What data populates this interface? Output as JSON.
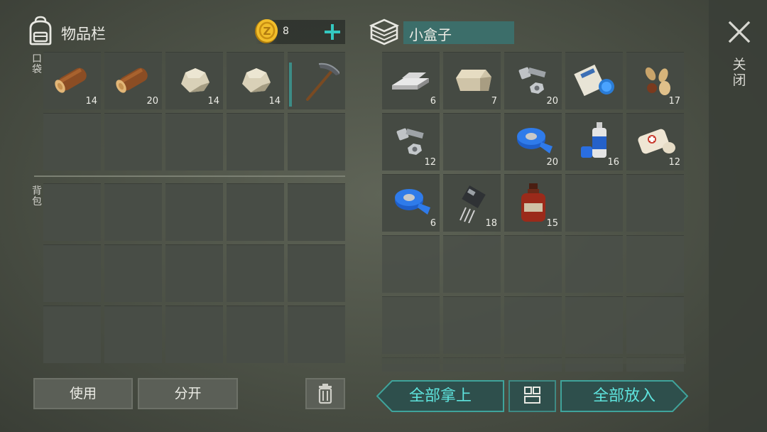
{
  "inventory": {
    "title": "物品栏",
    "coins": "8",
    "pocket_label": "口袋",
    "backpack_label": "背包",
    "pocket_slots": [
      {
        "item": "log-icon",
        "qty": "14"
      },
      {
        "item": "log-icon",
        "qty": "20"
      },
      {
        "item": "stone-icon",
        "qty": "14"
      },
      {
        "item": "stone-icon",
        "qty": "14"
      },
      {
        "item": "pickaxe-icon",
        "qty": ""
      },
      {
        "item": "",
        "qty": ""
      },
      {
        "item": "",
        "qty": ""
      },
      {
        "item": "",
        "qty": ""
      },
      {
        "item": "",
        "qty": ""
      },
      {
        "item": "",
        "qty": ""
      }
    ]
  },
  "container": {
    "name": "小盒子",
    "slots": [
      {
        "item": "iron-bars-icon",
        "qty": "6"
      },
      {
        "item": "stone-block-icon",
        "qty": "7"
      },
      {
        "item": "bolts-icon",
        "qty": "20"
      },
      {
        "item": "paper-roll-icon",
        "qty": ""
      },
      {
        "item": "seeds-icon",
        "qty": "17"
      },
      {
        "item": "bolts-icon",
        "qty": "12"
      },
      {
        "item": "",
        "qty": ""
      },
      {
        "item": "blue-tape-icon",
        "qty": "20"
      },
      {
        "item": "spray-paint-icon",
        "qty": "16"
      },
      {
        "item": "bandage-icon",
        "qty": "12"
      },
      {
        "item": "blue-tape-icon",
        "qty": "6"
      },
      {
        "item": "transistor-icon",
        "qty": "18"
      },
      {
        "item": "bottle-icon",
        "qty": "15"
      },
      {
        "item": "",
        "qty": ""
      },
      {
        "item": "",
        "qty": ""
      }
    ]
  },
  "actions": {
    "use": "使用",
    "split": "分开",
    "take_all": "全部拿上",
    "put_all": "全部放入",
    "close": "关闭"
  },
  "colors": {
    "accent_teal": "#5ee3dd",
    "box_name_bg": "#3c6e6a"
  }
}
